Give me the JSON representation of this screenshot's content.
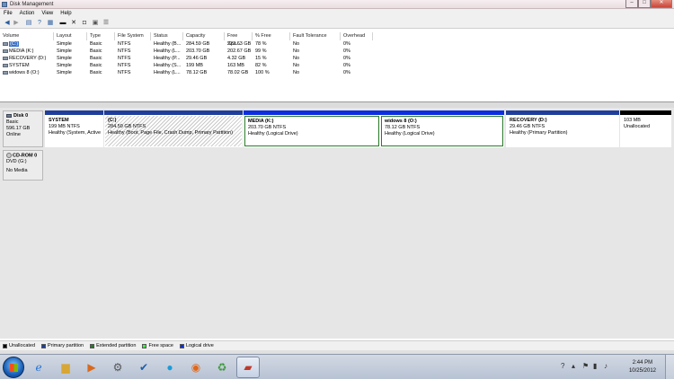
{
  "window": {
    "title": "Disk Management"
  },
  "menu": [
    "File",
    "Action",
    "View",
    "Help"
  ],
  "colors": {
    "primary": "#1f3e9c",
    "extended": "#2b7a2b",
    "free": "#3df03d",
    "logical": "#0a2ee0",
    "unallocated": "#000000"
  },
  "volumes": {
    "headers": [
      "Volume",
      "Layout",
      "Type",
      "File System",
      "Status",
      "Capacity",
      "Free Spa...",
      "% Free",
      "Fault Tolerance",
      "Overhead"
    ],
    "rows": [
      {
        "volume": "(C:)",
        "layout": "Simple",
        "type": "Basic",
        "fs": "NTFS",
        "status": "Healthy (B...",
        "capacity": "284.59 GB",
        "free": "222.63 GB",
        "pct": "78 %",
        "fault": "No",
        "overhead": "0%"
      },
      {
        "volume": "MEDIA (K:)",
        "layout": "Simple",
        "type": "Basic",
        "fs": "NTFS",
        "status": "Healthy (L...",
        "capacity": "203.70 GB",
        "free": "202.67 GB",
        "pct": "99 %",
        "fault": "No",
        "overhead": "0%"
      },
      {
        "volume": "RECOVERY (D:)",
        "layout": "Simple",
        "type": "Basic",
        "fs": "NTFS",
        "status": "Healthy (P...",
        "capacity": "29.46 GB",
        "free": "4.32 GB",
        "pct": "15 %",
        "fault": "No",
        "overhead": "0%"
      },
      {
        "volume": "SYSTEM",
        "layout": "Simple",
        "type": "Basic",
        "fs": "NTFS",
        "status": "Healthy (S...",
        "capacity": "199 MB",
        "free": "163 MB",
        "pct": "82 %",
        "fault": "No",
        "overhead": "0%"
      },
      {
        "volume": "widows 8 (O:)",
        "layout": "Simple",
        "type": "Basic",
        "fs": "NTFS",
        "status": "Healthy (L...",
        "capacity": "78.12 GB",
        "free": "78.02 GB",
        "pct": "100 %",
        "fault": "No",
        "overhead": "0%"
      }
    ]
  },
  "disk0": {
    "name": "Disk 0",
    "type": "Basic",
    "size": "596.17 GB",
    "status": "Online",
    "partitions": [
      {
        "name": "SYSTEM",
        "size": "199 MB NTFS",
        "status": "Healthy (System, Active"
      },
      {
        "name": "(C:)",
        "size": "284.59 GB NTFS",
        "status": "Healthy (Boot, Page File, Crash Dump, Primary Partition)"
      },
      {
        "name": "MEDIA  (K:)",
        "size": "203.70 GB NTFS",
        "status": "Healthy (Logical Drive)"
      },
      {
        "name": "widows 8  (O:)",
        "size": "78.12 GB NTFS",
        "status": "Healthy (Logical Drive)"
      },
      {
        "name": "RECOVERY  (D:)",
        "size": "29.46 GB NTFS",
        "status": "Healthy (Primary Partition)"
      },
      {
        "name": "",
        "size": "103 MB",
        "status": "Unallocated"
      }
    ]
  },
  "cdrom0": {
    "name": "CD-ROM 0",
    "type": "DVD (G:)",
    "status": "No Media"
  },
  "legend": [
    "Unallocated",
    "Primary partition",
    "Extended partition",
    "Free space",
    "Logical drive"
  ],
  "clock": {
    "time": "2:44 PM",
    "date": "10/25/2012"
  }
}
